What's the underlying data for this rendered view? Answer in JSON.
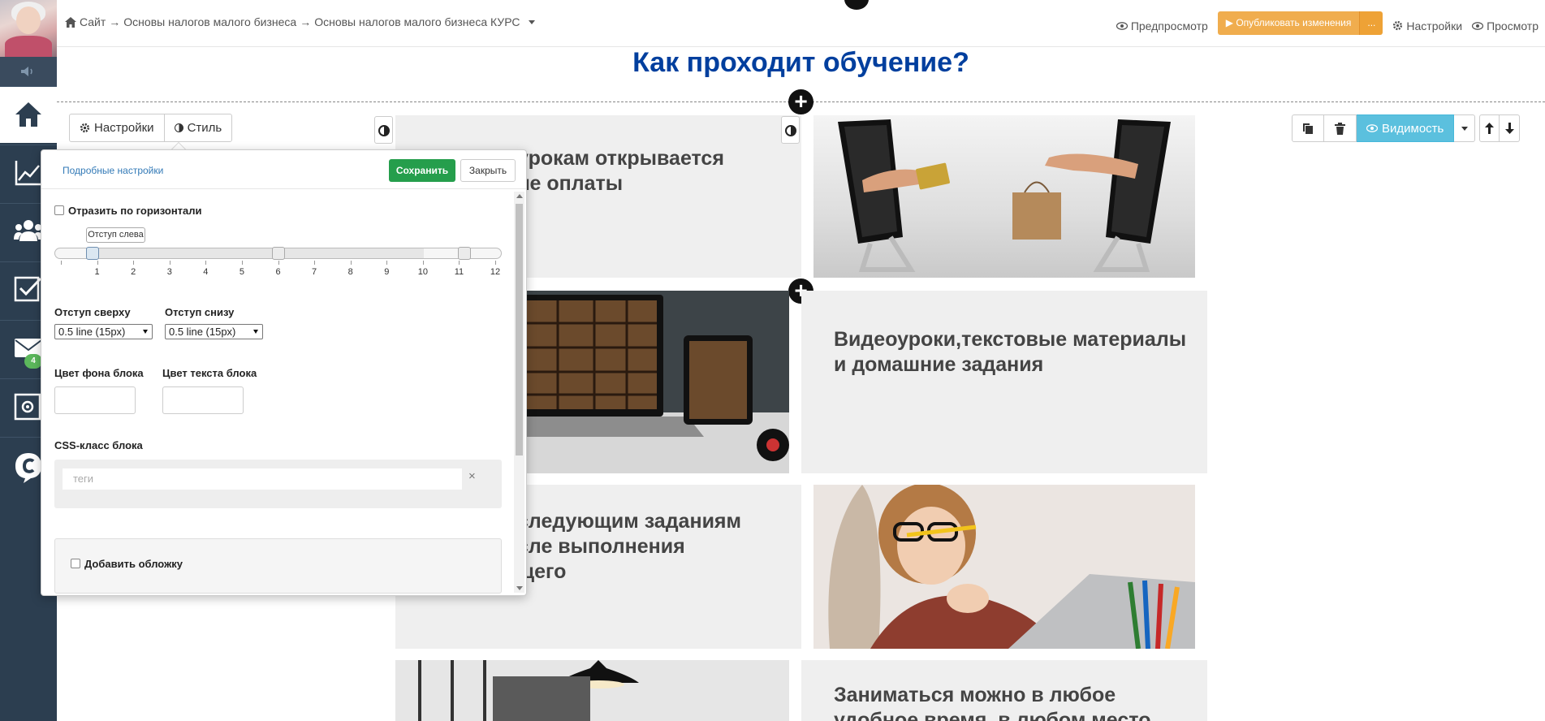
{
  "topbar": {
    "breadcrumb": [
      "Сайт",
      "Основы налогов малого бизнеса",
      "Основы налогов малого бизнеса КУРС"
    ],
    "breadcrumb_sep": "→",
    "preview_label": "Предпросмотр",
    "publish_label": "▶ Опубликовать изменения",
    "publish_more": "...",
    "settings_label": "Настройки",
    "view_label": "Просмотр"
  },
  "page": {
    "title": "Как проходит обучение?",
    "tiles": [
      {
        "text": "К урокам открывается после оплаты",
        "visible_text": "урокам открывается\nле оплаты"
      },
      {
        "text": "Видеоуроки,текстовые материалы и домашние задания"
      },
      {
        "text": "К следующим заданиям после выполнения текущего",
        "visible_text": "следующим заданиям\nсле выполнения\nщего"
      },
      {
        "text": "Заниматься можно в любое удобное время, в любом месте",
        "visible_text": "Заниматься можно в любое\nудобное время, в любом место"
      }
    ]
  },
  "block_toolbar": {
    "visibility_label": "Видимость"
  },
  "settings_panel": {
    "tabs": [
      "Настройки",
      "Стиль"
    ],
    "advanced_link": "Подробные настройки",
    "save_label": "Сохранить",
    "close_label": "Закрыть",
    "mirror_label": "Отразить по горизонтали",
    "mirror_checked": false,
    "slider": {
      "tooltip": "Отступ слева",
      "min": 0,
      "max": 12,
      "tick_labels": [
        "1",
        "2",
        "3",
        "4",
        "5",
        "6",
        "7",
        "8",
        "9",
        "10",
        "11",
        "12"
      ],
      "handles": [
        1,
        6,
        11
      ]
    },
    "padding_top_label": "Отступ сверху",
    "padding_top_value": "0.5 line (15px)",
    "padding_bottom_label": "Отступ снизу",
    "padding_bottom_value": "0.5 line (15px)",
    "bg_color_label": "Цвет фона блока",
    "text_color_label": "Цвет текста блока",
    "css_class_label": "CSS-класс блока",
    "tags_placeholder": "теги",
    "tags_clear": "×",
    "add_cover_label": "Добавить обложку",
    "add_cover_checked": false
  },
  "sidebar": {
    "items": [
      "home-icon",
      "chart-icon",
      "users-icon",
      "tasks-icon",
      "mail-icon",
      "safe-icon",
      "chat-icon"
    ],
    "mail_badge": "4"
  },
  "colors": {
    "sidebar": "#2c3e50",
    "title": "#003f9e",
    "publish": "#f0ad4e",
    "save": "#259e4c",
    "visibility": "#5bc0de",
    "badge": "#5cb85c"
  }
}
